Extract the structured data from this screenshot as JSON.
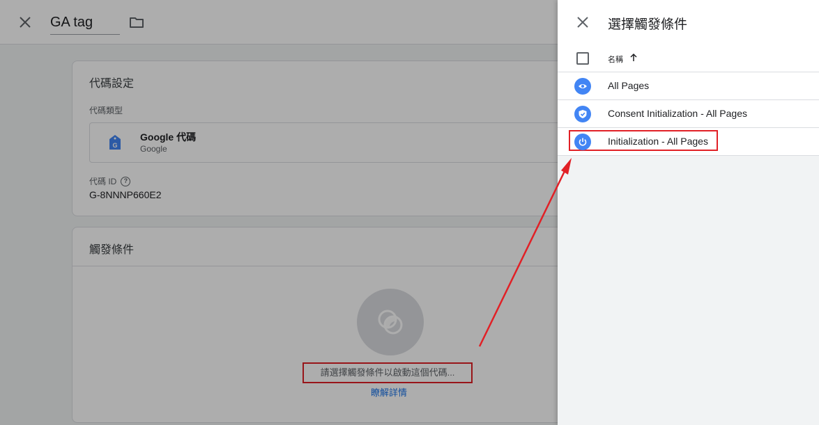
{
  "editor": {
    "tag_name": "GA tag",
    "config_card": {
      "title": "代碼設定",
      "type_label": "代碼類型",
      "type_name": "Google 代碼",
      "type_vendor": "Google",
      "tag_id_label": "代碼 ID",
      "tag_id": "G-8NNNP660E2"
    },
    "trigger_card": {
      "title": "觸發條件",
      "prompt": "請選擇觸發條件以啟動這個代碼...",
      "learn_more": "瞭解詳情"
    }
  },
  "panel": {
    "title": "選擇觸發條件",
    "column_header": "名稱",
    "triggers": [
      {
        "label": "All Pages",
        "icon": "eye-icon"
      },
      {
        "label": "Consent Initialization - All Pages",
        "icon": "shield-icon"
      },
      {
        "label": "Initialization - All Pages",
        "icon": "power-icon"
      }
    ]
  },
  "colors": {
    "accent": "#4285f4",
    "link": "#1a73e8",
    "annotation": "#e12026"
  }
}
